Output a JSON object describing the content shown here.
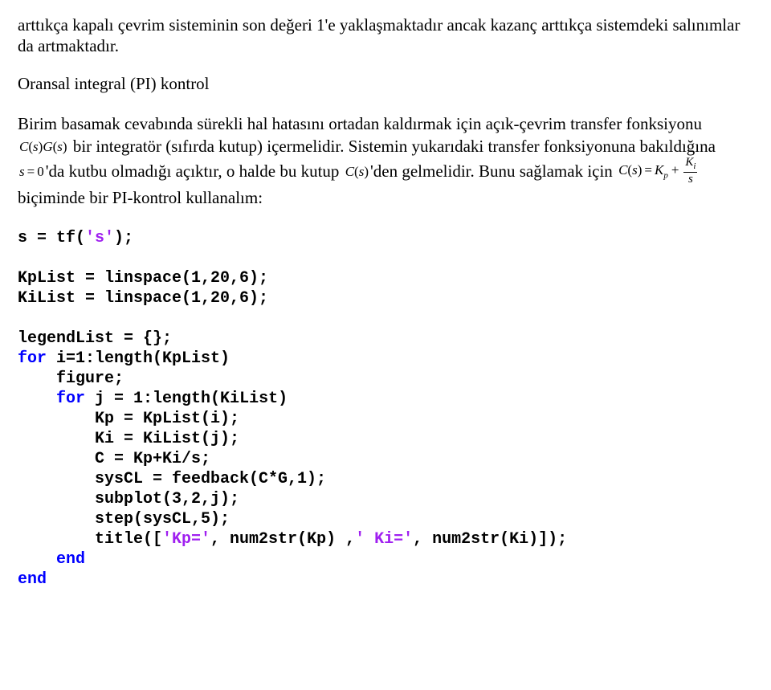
{
  "para1": "arttıkça kapalı çevrim sisteminin son değeri 1'e yaklaşmaktadır ancak kazanç arttıkça sistemdeki salınımlar da artmaktadır.",
  "heading": "Oransal integral (PI) kontrol",
  "para2_a": "Birim basamak cevabında sürekli hal hatasını ortadan kaldırmak için açık-çevrim transfer fonksiyonu ",
  "para2_b": " bir integratör (sıfırda kutup) içermelidir. Sistemin yukarıdaki transfer fonksiyonuna bakıldığına ",
  "para2_c": "'da kutbu olmadığı açıktır, o halde bu kutup ",
  "para2_d": "'den gelmelidir. Bunu sağlamak için ",
  "para2_e": " biçiminde bir PI-kontrol kullanalım:",
  "math": {
    "csgs_c": "C",
    "csgs_s1": "s",
    "csgs_g": "G",
    "csgs_s2": "s",
    "s_eq_0_lhs": "s",
    "s_eq_0_rhs": "0",
    "cs_c": "C",
    "cs_s": "s",
    "cdef_c": "C",
    "cdef_s": "s",
    "cdef_kp": "K",
    "cdef_kp_sub": "p",
    "cdef_ki": "K",
    "cdef_ki_sub": "i",
    "cdef_den": "s"
  },
  "code": {
    "l01a": "s = tf(",
    "l01b": "'s'",
    "l01c": ");",
    "l03": "KpList = linspace(1,20,6);",
    "l04": "KiList = linspace(1,20,6);",
    "l06": "legendList = {};",
    "l07kw": "for",
    "l07": " i=1:length(KpList)",
    "l08": "    figure;",
    "l09kw": "for",
    "l09pre": "    ",
    "l09": " j = 1:length(KiList)",
    "l10": "        Kp = KpList(i);",
    "l11": "        Ki = KiList(j);",
    "l12": "        C = Kp+Ki/s;",
    "l13": "        sysCL = feedback(C*G,1);",
    "l14": "        subplot(3,2,j);",
    "l15": "        step(sysCL,5);",
    "l16a": "        title([",
    "l16s1": "'Kp='",
    "l16b": ", num2str(Kp) ,",
    "l16s2": "' Ki='",
    "l16c": ", num2str(Ki)]);",
    "l17pre": "    ",
    "l17kw": "end",
    "l18kw": "end"
  }
}
